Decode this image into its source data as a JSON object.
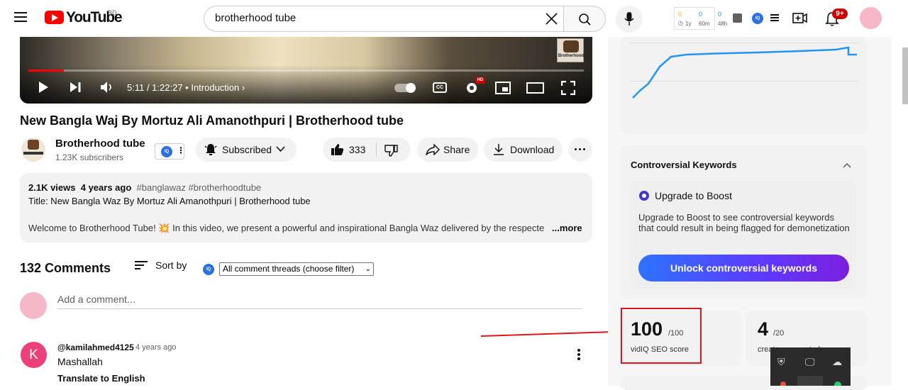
{
  "header": {
    "logo_text": "YouTube",
    "country_code": "BD",
    "search_value": "brotherhood tube",
    "vidiq_stats": [
      {
        "value": "0",
        "label": "1y"
      },
      {
        "value": "0",
        "label": "60m"
      },
      {
        "value": "0",
        "label": "48h"
      }
    ],
    "vidiq_badge": "IQ",
    "notification_count": "9+"
  },
  "player": {
    "time": "5:11 / 1:22:27",
    "chapter": "• Introduction",
    "hd_badge": "HD",
    "progress_fraction": 0.064,
    "brand_label": "Brotherhood"
  },
  "video": {
    "title": "New Bangla Waj By Mortuz Ali Amanothpuri | Brotherhood tube",
    "channel_name": "Brotherhood tube",
    "subscribers": "1.23K subscribers",
    "subscribed_label": "Subscribed",
    "likes": "333",
    "share_label": "Share",
    "download_label": "Download",
    "vidiq_badge": "IQ"
  },
  "description": {
    "views": "2.1K views",
    "date": "4 years ago",
    "hashtags": "#banglawaz #brotherhoodtube",
    "title_line": "Title: New Bangla Waz By Mortuz Ali Amanothpuri | Brotherhood tube",
    "welcome_line": "Welcome to Brotherhood Tube! 💥 In this video, we present a powerful and inspirational Bangla Waz delivered by the respecte",
    "more_label": "...more"
  },
  "comments": {
    "count_label": "132 Comments",
    "sort_label": "Sort by",
    "vidiq_badge": "IQ",
    "filter_value": "All comment threads (choose filter)",
    "add_placeholder": "Add a comment...",
    "items": [
      {
        "avatar_letter": "K",
        "author": "@kamilahmed4125",
        "date": "4 years ago",
        "text": "Mashallah",
        "translate_label": "Translate to English"
      }
    ]
  },
  "sidebar": {
    "controversial_title": "Controversial Keywords",
    "boost_title": "Upgrade to Boost",
    "boost_description": "Upgrade to Boost to see controversial keywords that could result in being flagged for demonetization",
    "unlock_label": "Unlock controversial keywords",
    "seo_score": "100",
    "seo_max": "/100",
    "seo_label": "vidIQ SEO score",
    "second_score": "4",
    "second_max": "/20",
    "second_label": "creator suggested",
    "chart_line_color": "#2196f3"
  },
  "colors": {
    "brand_red": "#ff0000",
    "annotation_red": "#e0161b",
    "vidiq_blue": "#2b6fe0",
    "avatar_pink": "#ec407a"
  }
}
